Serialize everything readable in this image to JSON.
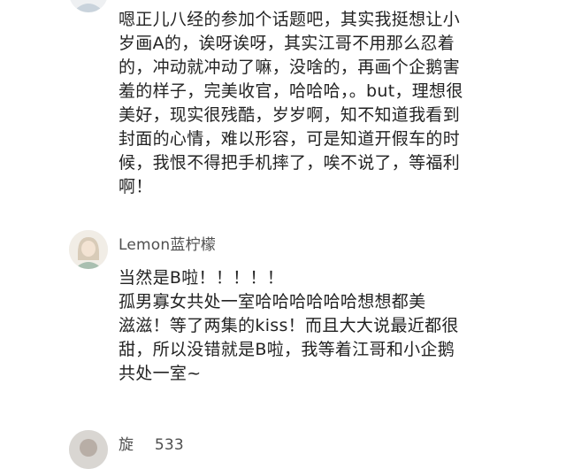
{
  "comments": [
    {
      "username": "",
      "avatar_icon": "user-avatar-icon",
      "text": "嗯正儿八经的参加个话题吧，其实我挺想让小\n岁画A的，诶呀诶呀，其实江哥不用那么忍着\n的，冲动就冲动了嘛，没啥的，再画个企鹅害\n羞的样子，完美收官，哈哈哈，。but，理想很\n美好，现实很残酷，岁岁啊，知不知道我看到\n封面的心情，难以形容，可是知道开假车的时\n候，我恨不得把手机摔了，唉不说了，等福利\n啊！"
    },
    {
      "username": "Lemon蓝柠檬",
      "avatar_icon": "user-avatar-icon",
      "text": "当然是B啦！！！！！\n孤男寡女共处一室哈哈哈哈哈哈想想都美\n滋滋！等了两集的kiss！而且大大说最近都很\n甜，所以没错就是B啦，我等着江哥和小企鹅\n共处一室~"
    },
    {
      "username": "旋",
      "username_suffix": "533",
      "avatar_icon": "user-avatar-icon",
      "text": ""
    }
  ]
}
